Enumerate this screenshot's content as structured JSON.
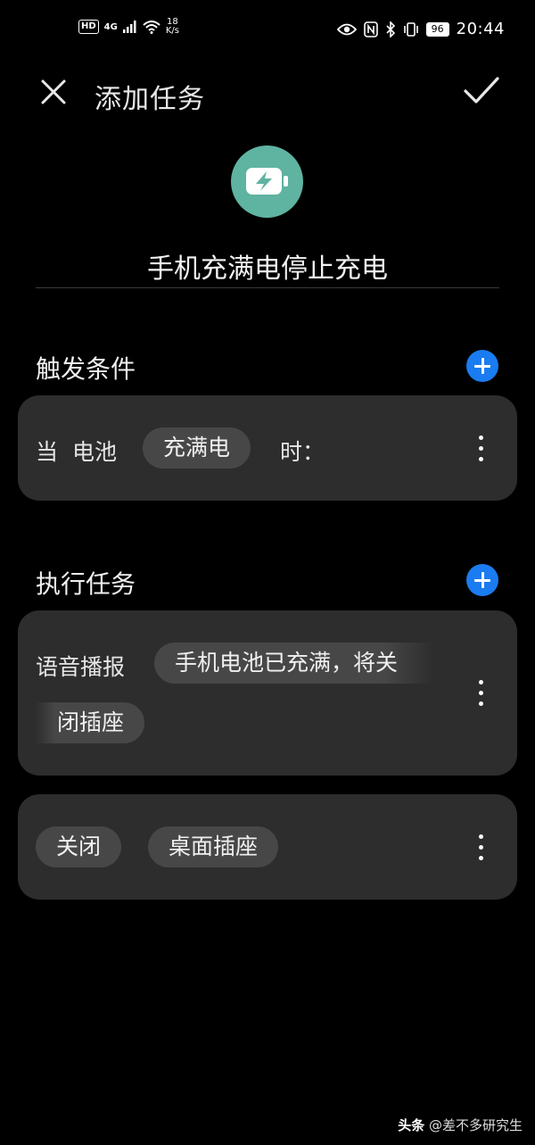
{
  "status_bar": {
    "hd": "HD",
    "network": "4G",
    "speed_value": "18",
    "speed_unit": "K/s",
    "battery": "96",
    "time": "20:44"
  },
  "header": {
    "title": "添加任务",
    "close_icon": "close-icon",
    "confirm_icon": "check-icon"
  },
  "task": {
    "icon": "battery-charging-icon",
    "icon_bg": "#5fb3a1",
    "name": "手机充满电停止充电"
  },
  "trigger_section": {
    "title": "触发条件",
    "condition": {
      "prefix": "当",
      "subject": "电池",
      "state": "充满电",
      "suffix": "时："
    }
  },
  "action_section": {
    "title": "执行任务",
    "actions": [
      {
        "label": "语音播报",
        "text_line1": "手机电池已充满，将关",
        "text_line2": "闭插座"
      },
      {
        "verb": "关闭",
        "target": "桌面插座"
      }
    ]
  },
  "colors": {
    "accent": "#1a7cf0",
    "card_bg": "#2d2d2d",
    "chip_bg": "#474747"
  },
  "watermark": {
    "brand": "头条",
    "author": "@差不多研究生"
  }
}
